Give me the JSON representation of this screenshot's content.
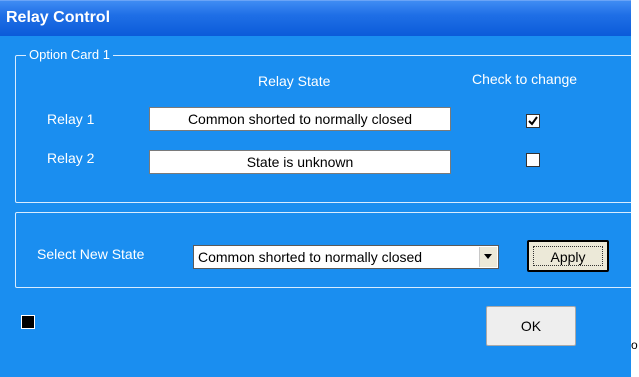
{
  "window": {
    "title": "Relay Control"
  },
  "option_card": {
    "legend": "Option Card 1",
    "header_state": "Relay State",
    "header_check": "Check to change",
    "relays": [
      {
        "label": "Relay 1",
        "state": "Common shorted to normally closed",
        "checked": true
      },
      {
        "label": "Relay 2",
        "state": "State is unknown",
        "checked": false
      }
    ]
  },
  "new_state": {
    "label": "Select New State",
    "selected": "Common shorted to normally closed",
    "apply_label": "Apply"
  },
  "footer": {
    "ok_label": "OK",
    "stray_text": "o"
  },
  "colors": {
    "window_bg": "#1a8ef0",
    "title_bg": "#0b5bd9",
    "indicator": "#000000"
  }
}
